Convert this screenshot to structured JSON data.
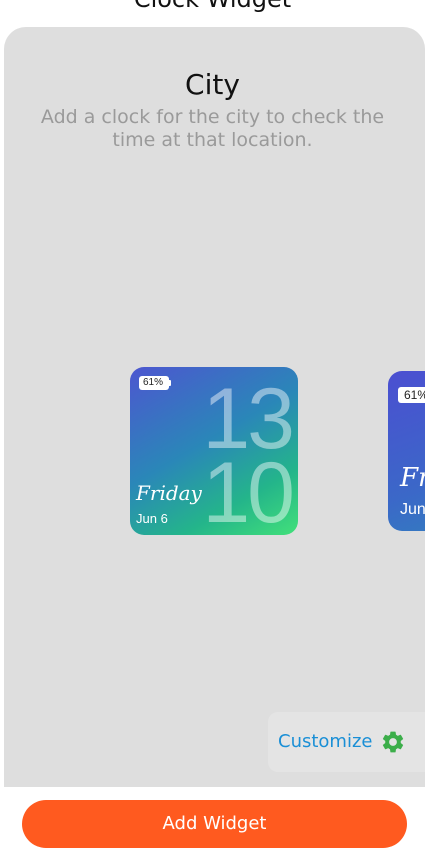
{
  "header": {
    "title": "Clock Widget"
  },
  "card": {
    "title": "City",
    "description": "Add a clock for the city to check the time at that location."
  },
  "widget": {
    "battery": "61%",
    "hour": "13",
    "minute": "10",
    "day": "Friday",
    "date": "Jun 6"
  },
  "widget_peek": {
    "battery": "61%",
    "day": "Fr",
    "date": "Jun"
  },
  "customize": {
    "label": "Customize",
    "icon": "gear-icon",
    "icon_color": "#3cae4a"
  },
  "footer": {
    "add_button_label": "Add Widget",
    "button_color": "#ff5a1f"
  }
}
